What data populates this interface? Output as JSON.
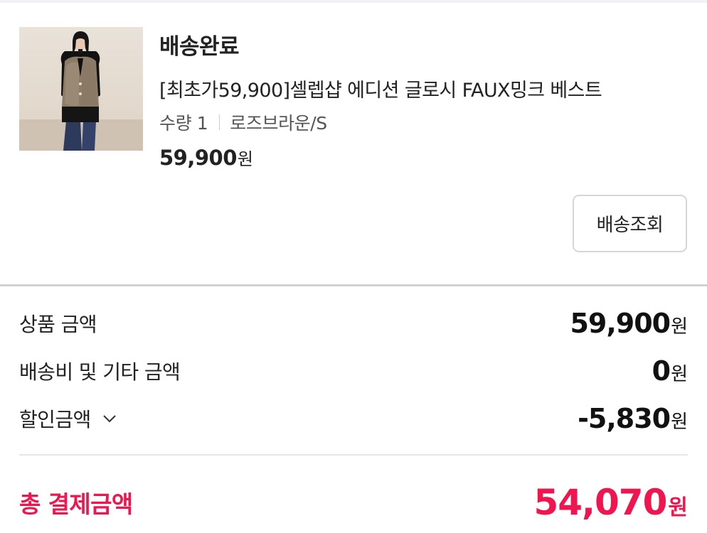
{
  "order": {
    "status": "배송완료",
    "product_name": "[최초가59,900]셀렙샵 에디션 글로시 FAUX밍크 베스트",
    "quantity_text": "수량 1",
    "option_text": "로즈브라운/S",
    "price": "59,900",
    "currency": "원",
    "track_button_label": "배송조회"
  },
  "summary": {
    "rows": [
      {
        "label": "상품 금액",
        "value": "59,900",
        "currency": "원"
      },
      {
        "label": "배송비 및 기타 금액",
        "value": "0",
        "currency": "원"
      },
      {
        "label": "할인금액",
        "value": "-5,830",
        "currency": "원",
        "icon": "chevron-down-icon"
      }
    ],
    "total": {
      "label": "총 결제금액",
      "value": "54,070",
      "currency": "원"
    }
  },
  "colors": {
    "accent": "#f0154f",
    "divider": "#cfcfd4"
  }
}
